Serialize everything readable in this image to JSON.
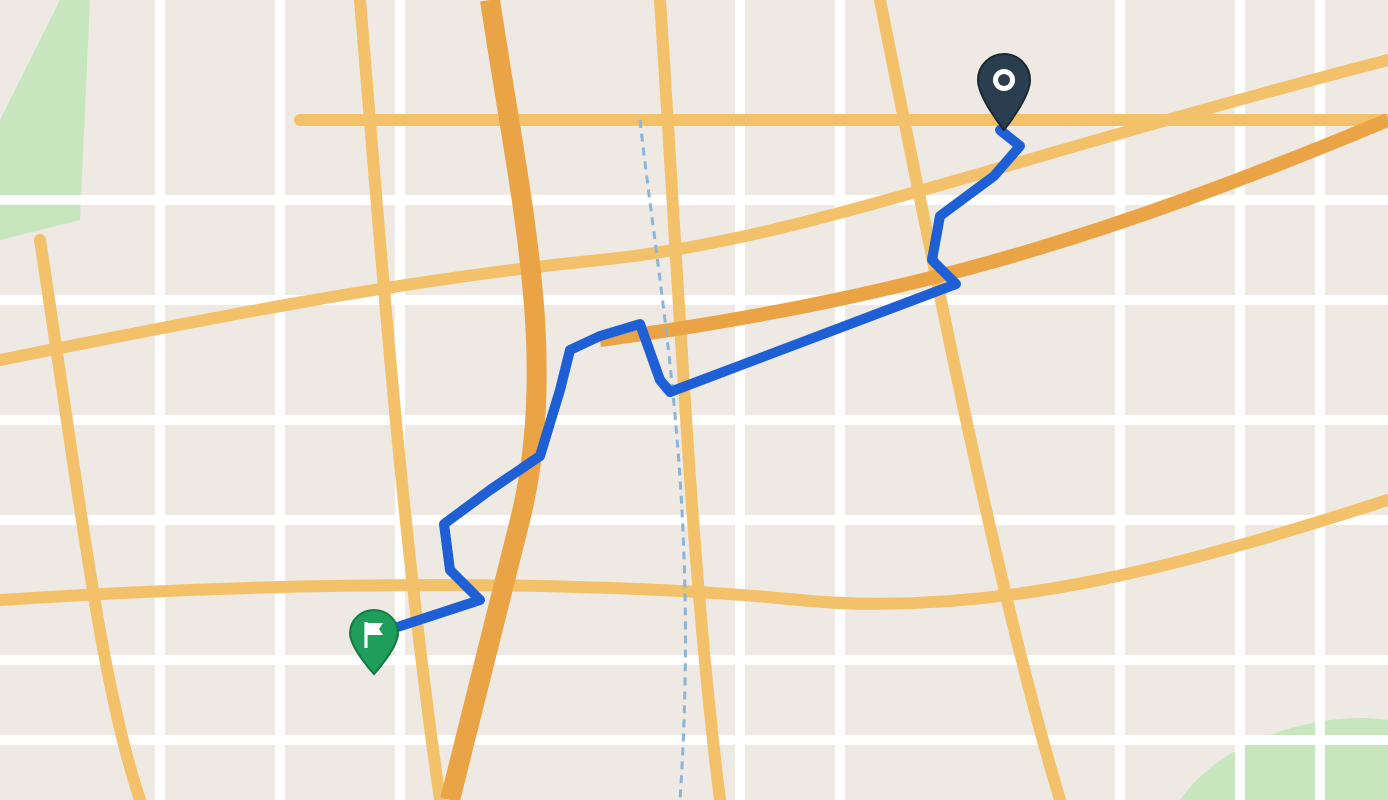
{
  "map": {
    "markers": [
      {
        "kind": "start"
      },
      {
        "kind": "finish"
      }
    ]
  }
}
